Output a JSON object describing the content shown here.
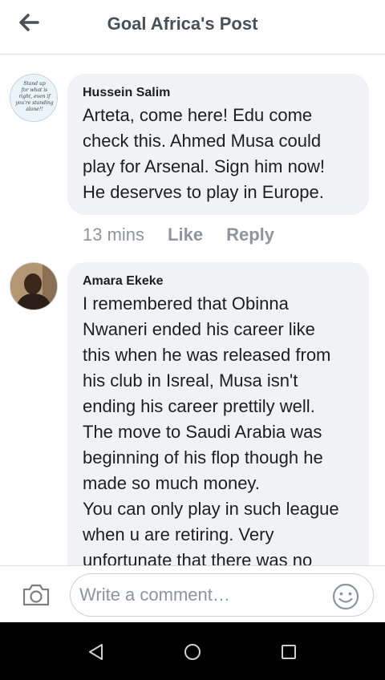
{
  "header": {
    "title": "Goal Africa's Post",
    "back_icon": "arrow-left-icon"
  },
  "comments": [
    {
      "author": "Hussein Salim",
      "avatar_text": "Stand up for what is right, even if you're standing alone!!",
      "text": "Arteta, come here! Edu come\ncheck this.  Ahmed Musa could\nplay for Arsenal. Sign him now!\nHe deserves to play in Europe.",
      "time": "13 mins",
      "like_label": "Like",
      "reply_label": "Reply"
    },
    {
      "author": "Amara Ekeke",
      "text": "I remembered that Obinna\nNwaneri ended his career like\nthis when he was released from\nhis club in Isreal,  Musa isn't\nending his career prettily well.\nThe move to Saudi Arabia was\nbeginning of his flop though he\nmade so much money.\nYou can only play in such league\nwhen u are retiring. Very\nunfortunate that there was no"
    }
  ],
  "composer": {
    "placeholder": "Write a comment…",
    "camera_icon": "camera-icon",
    "emoji_icon": "emoji-icon"
  },
  "system_nav": {
    "back_icon": "nav-back-icon",
    "home_icon": "nav-home-icon",
    "recents_icon": "nav-recents-icon"
  },
  "colors": {
    "bubble": "#f0f2f5",
    "meta_text": "#90949c",
    "title_text": "#4b4f56",
    "nav_bar": "#000000"
  }
}
